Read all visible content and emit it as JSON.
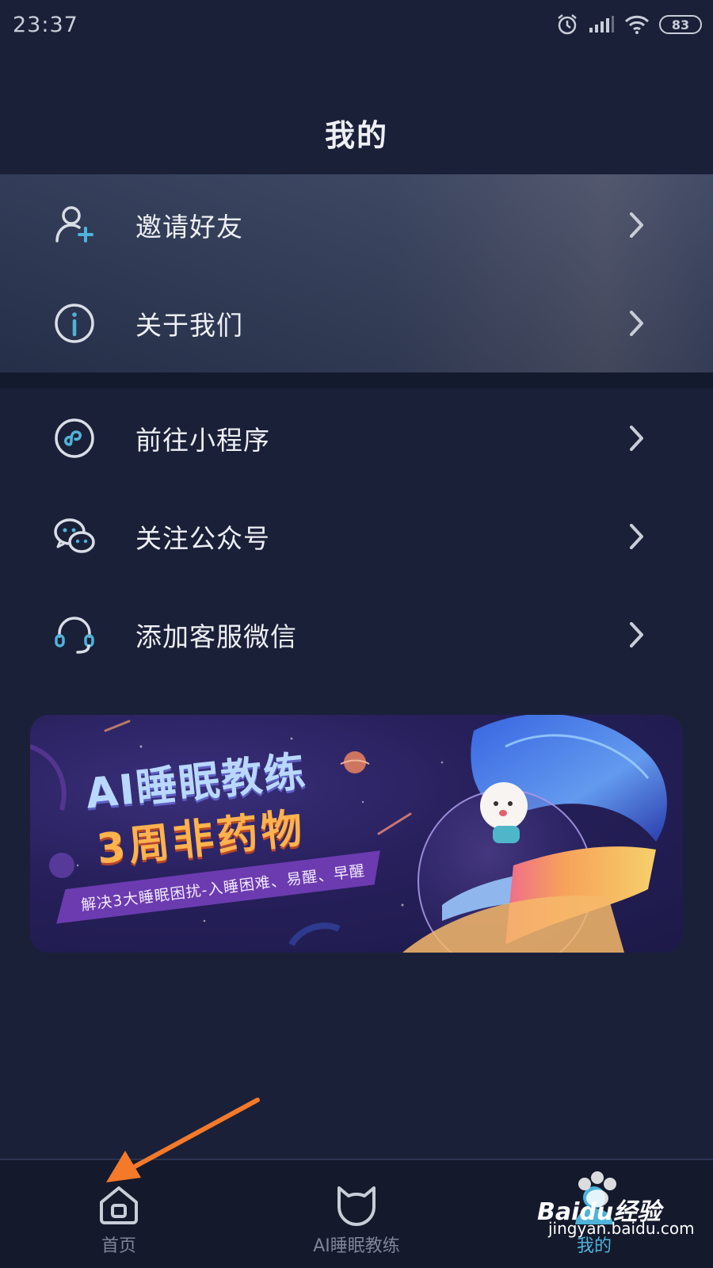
{
  "status_bar": {
    "time": "23:37",
    "battery": "83",
    "icons": [
      "alarm-icon",
      "signal-icon",
      "wifi-icon",
      "battery-icon"
    ]
  },
  "header": {
    "title": "我的"
  },
  "menu": {
    "group1": [
      {
        "label": "邀请好友",
        "icon": "add-user-icon"
      },
      {
        "label": "关于我们",
        "icon": "info-icon"
      }
    ],
    "group2": [
      {
        "label": "前往小程序",
        "icon": "mini-program-icon"
      },
      {
        "label": "关注公众号",
        "icon": "wechat-icon"
      },
      {
        "label": "添加客服微信",
        "icon": "headset-icon"
      }
    ]
  },
  "banner": {
    "title": "AI睡眠教练",
    "subtitle": "3周非药物",
    "ribbon": "解决3大睡眠困扰-入睡困难、易醒、早醒"
  },
  "tab_bar": {
    "tabs": [
      {
        "label": "首页",
        "icon": "home-icon",
        "active": false
      },
      {
        "label": "AI睡眠教练",
        "icon": "cat-face-icon",
        "active": false
      },
      {
        "label": "我的",
        "icon": "profile-icon",
        "active": true
      }
    ]
  },
  "watermark": {
    "brand": "Baidu经验",
    "url": "jingyan.baidu.com"
  },
  "colors": {
    "background": "#1a2038",
    "accent": "#4fb3d9",
    "annotation_arrow": "#f47a2a"
  }
}
